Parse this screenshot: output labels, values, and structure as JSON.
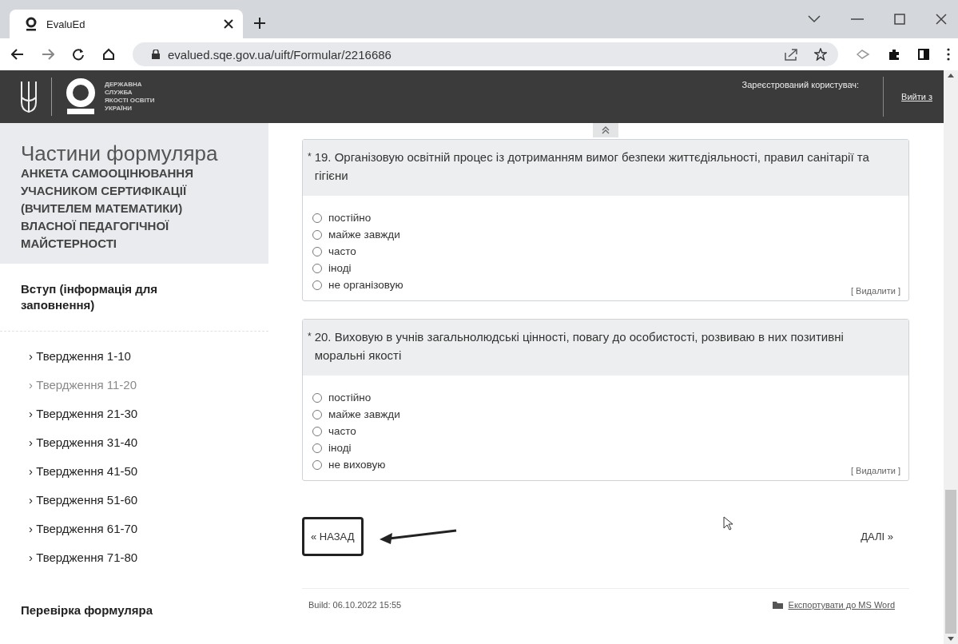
{
  "browser": {
    "tab": {
      "title": "EvaluEd"
    },
    "url": "evalued.sqe.gov.ua/uift/Formular/2216686"
  },
  "header": {
    "logo_lines": [
      "ДЕРЖАВНА",
      "СЛУЖБА",
      "ЯКОСТІ ОСВІТИ",
      "УКРАЇНИ"
    ],
    "user_label": "Зареєстрований користувач:",
    "logout": "Вийти з"
  },
  "sidebar": {
    "title": "Частини формуляра",
    "subtitle": "АНКЕТА САМООЦІНЮВАННЯ УЧАСНИКОМ СЕРТИФІКАЦІЇ (ВЧИТЕЛЕМ МАТЕМАТИКИ) ВЛАСНОЇ ПЕДАГОГІЧНОЇ МАЙСТЕРНОСТІ",
    "intro": "Вступ (інформація для заповнення)",
    "items": [
      {
        "label": "› Твердження 1-10",
        "selected": false
      },
      {
        "label": "› Твердження 11-20",
        "selected": true
      },
      {
        "label": "› Твердження 21-30",
        "selected": false
      },
      {
        "label": "› Твердження 31-40",
        "selected": false
      },
      {
        "label": "› Твердження 41-50",
        "selected": false
      },
      {
        "label": "› Твердження 51-60",
        "selected": false
      },
      {
        "label": "› Твердження 61-70",
        "selected": false
      },
      {
        "label": "› Твердження 71-80",
        "selected": false
      }
    ],
    "check": "Перевірка формуляра"
  },
  "questions": [
    {
      "mark": "*",
      "text": "19. Організовую освітній процес із дотриманням вимог безпеки життєдіяльності, правил санітарії та гігієни",
      "options": [
        {
          "label": "постійно",
          "selected": false
        },
        {
          "label": "майже завжди",
          "selected": false
        },
        {
          "label": "часто",
          "selected": false
        },
        {
          "label": "іноді",
          "selected": false
        },
        {
          "label": "не організовую",
          "selected": false
        }
      ],
      "delete": "[ Видалити ]"
    },
    {
      "mark": "*",
      "text": "20. Виховую в учнів загальнолюдські цінності, повагу до особистості, розвиваю в них позитивні моральні якості",
      "options": [
        {
          "label": "постійно",
          "selected": false
        },
        {
          "label": "майже завжди",
          "selected": false
        },
        {
          "label": "часто",
          "selected": false
        },
        {
          "label": "іноді",
          "selected": false
        },
        {
          "label": "не виховую",
          "selected": false
        }
      ],
      "delete": "[ Видалити ]"
    }
  ],
  "nav": {
    "back": {
      "label": "« НАЗАД",
      "highlighted": true
    },
    "next": "ДАЛІ »"
  },
  "footer": {
    "build": "Build: 06.10.2022 15:55",
    "export": "Експортувати до MS Word"
  }
}
